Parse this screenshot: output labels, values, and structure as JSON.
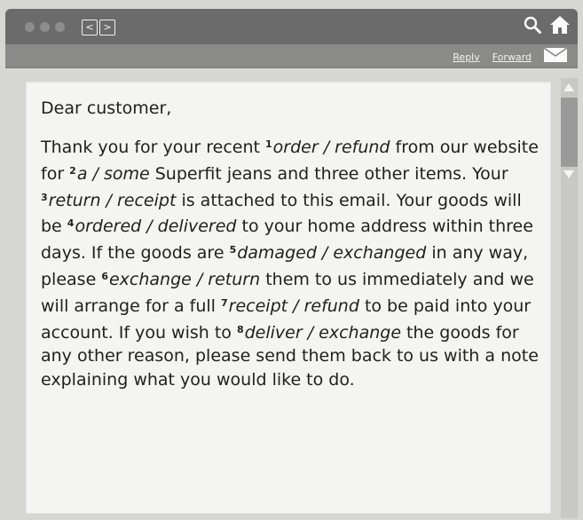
{
  "window": {
    "nav_back": "<",
    "nav_forward": ">"
  },
  "toolbar": {
    "reply_label": "Reply",
    "forward_label": "Forward"
  },
  "email": {
    "greeting": "Dear customer,",
    "segments": {
      "s1": "Thank you for your recent ",
      "n1": "1",
      "o1": "order / refund",
      "s2": " from our website for ",
      "n2": "2",
      "o2": "a / some",
      "s3": " Superfit jeans and three other items. Your ",
      "n3": "3",
      "o3": "return / receipt",
      "s4": " is attached to this email. Your goods will be ",
      "n4": "4",
      "o4": "ordered / delivered",
      "s5": " to your home address within three days. If the goods are ",
      "n5": "5",
      "o5": "damaged / exchanged",
      "s6": " in any way, please ",
      "n6": "6",
      "o6": "exchange / return",
      "s7": " them to us immediately and we will arrange for a full ",
      "n7": "7",
      "o7": "receipt / refund",
      "s8": " to be paid into your account. If you wish to ",
      "n8": "8",
      "o8": "deliver / exchange",
      "s9": " the goods for any other reason, please send them back to us with a note explaining what you would like to do."
    }
  },
  "icons": {
    "search": "search-icon",
    "home": "home-icon",
    "mail": "envelope-icon",
    "scroll_up": "scroll-up-arrow",
    "scroll_down": "scroll-down-arrow"
  },
  "colors": {
    "titlebar": "#6b6b6b",
    "toolbar": "#8a8a89",
    "mail_background": "#f4f4f2",
    "text": "#1f1f1f"
  }
}
